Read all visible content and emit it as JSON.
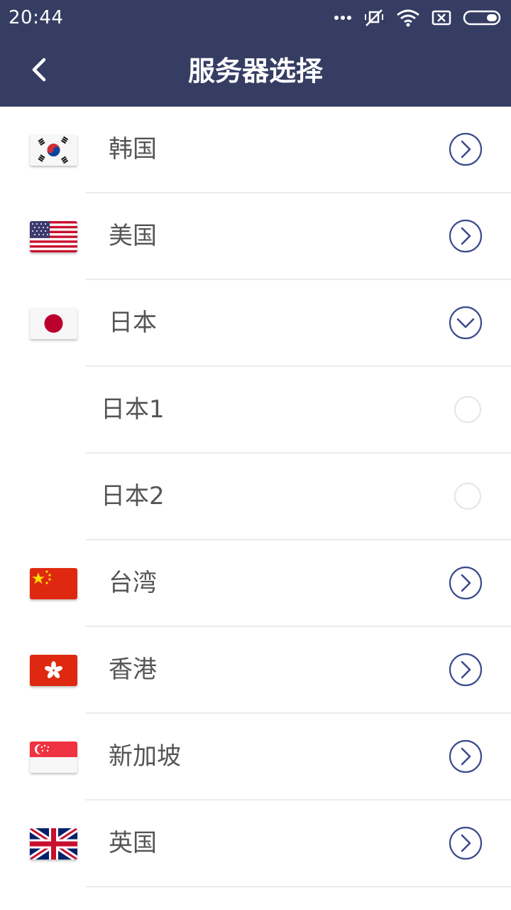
{
  "status_bar": {
    "time": "20:44",
    "icons": [
      "more-dots-icon",
      "mute-icon",
      "wifi-icon",
      "sim-x-icon",
      "battery-icon"
    ]
  },
  "header": {
    "title": "服务器选择",
    "back_icon": "back-chevron-icon"
  },
  "colors": {
    "primary": "#353d63",
    "text": "#555555",
    "divider": "#ececec",
    "icon_stroke": "#3a4a8c"
  },
  "servers": [
    {
      "label": "韩国",
      "flag": "korea-flag-icon",
      "action": "expand-arrow-icon"
    },
    {
      "label": "美国",
      "flag": "usa-flag-icon",
      "action": "expand-arrow-icon"
    },
    {
      "label": "日本",
      "flag": "japan-flag-icon",
      "action": "collapse-arrow-icon",
      "expanded": true,
      "children": [
        {
          "label": "日本1",
          "selected": false
        },
        {
          "label": "日本2",
          "selected": false
        }
      ]
    },
    {
      "label": "台湾",
      "flag": "china-flag-icon",
      "action": "expand-arrow-icon"
    },
    {
      "label": "香港",
      "flag": "hongkong-flag-icon",
      "action": "expand-arrow-icon"
    },
    {
      "label": "新加坡",
      "flag": "singapore-flag-icon",
      "action": "expand-arrow-icon"
    },
    {
      "label": "英国",
      "flag": "uk-flag-icon",
      "action": "expand-arrow-icon"
    }
  ]
}
